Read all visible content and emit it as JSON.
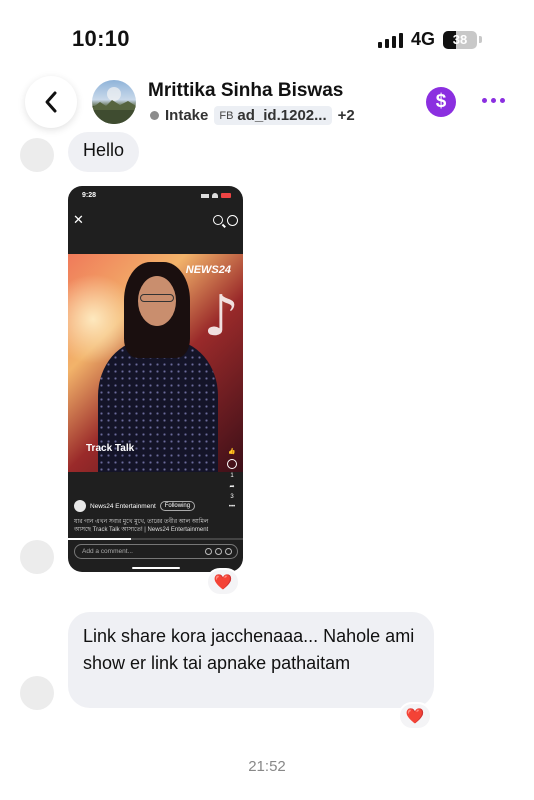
{
  "status_bar": {
    "time": "10:10",
    "network": "4G",
    "battery": "38"
  },
  "header": {
    "contact_name": "Mrittika Sinha Biswas",
    "stage": "Intake",
    "ad_prefix": "FB",
    "ad_id": "ad_id.1202...",
    "extra_tags": "+2",
    "payment_icon_char": "$"
  },
  "messages": [
    {
      "text": "Hello"
    },
    {
      "attachment": {
        "time": "9:28",
        "channel": "News24 Entertainment",
        "follow_label": "Following",
        "caption": "যার গান এখন সবার মুখে মুখে, তারের তবীর আল আমিল আসছে Track Talk আসাতে! | News24 Entertainment",
        "comment_placeholder": "Add a comment...",
        "logo_text": "NEWS24",
        "show_text": "Track Talk",
        "comment_count": "1",
        "share_count": "3"
      },
      "reaction": "❤️"
    },
    {
      "text": "Link share kora jacchenaaa... Nahole ami show er link tai apnake pathaitam",
      "reaction": "❤️"
    }
  ],
  "timestamp": "21:52",
  "colors": {
    "accent": "#8b2fe0",
    "bubble": "#eff0f4"
  }
}
